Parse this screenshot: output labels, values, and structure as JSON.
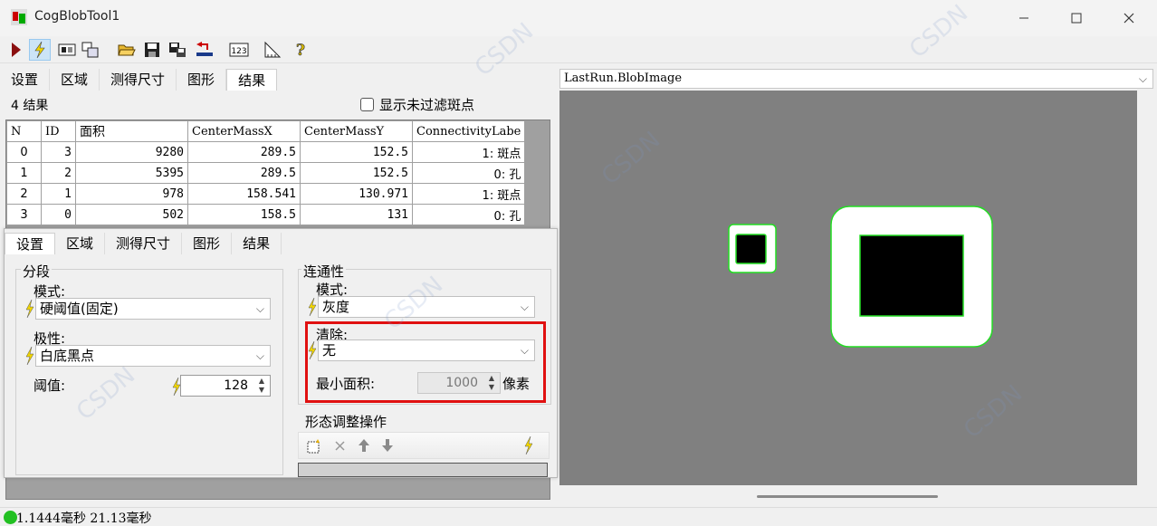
{
  "window": {
    "title": "CogBlobTool1"
  },
  "top_tabs": [
    "设置",
    "区域",
    "测得尺寸",
    "图形",
    "结果"
  ],
  "results": {
    "count_label": "4 结果",
    "show_unfiltered_label": "显示未过滤斑点",
    "columns": [
      "N",
      "ID",
      "面积",
      "CenterMassX",
      "CenterMassY",
      "ConnectivityLabe"
    ],
    "rows": [
      [
        "0",
        "3",
        "9280",
        "289.5",
        "152.5",
        "1: 斑点"
      ],
      [
        "1",
        "2",
        "5395",
        "289.5",
        "152.5",
        "0: 孔"
      ],
      [
        "2",
        "1",
        "978",
        "158.541",
        "130.971",
        "1: 斑点"
      ],
      [
        "3",
        "0",
        "502",
        "158.5",
        "131",
        "0: 孔"
      ]
    ]
  },
  "panel_tabs": [
    "设置",
    "区域",
    "测得尺寸",
    "图形",
    "结果"
  ],
  "segmentation": {
    "group_title": "分段",
    "mode_label": "模式:",
    "mode_value": "硬阈值(固定)",
    "polarity_label": "极性:",
    "polarity_value": "白底黑点",
    "threshold_label": "阈值:",
    "threshold_value": "128"
  },
  "connectivity": {
    "group_title": "连通性",
    "mode_label": "模式:",
    "mode_value": "灰度",
    "clear_label": "清除:",
    "clear_value": "无",
    "min_area_label": "最小面积:",
    "min_area_value": "1000",
    "min_area_unit": "像素"
  },
  "morphology": {
    "group_title": "形态调整操作"
  },
  "image_selector": {
    "value": "LastRun.BlobImage"
  },
  "status": {
    "text": "1.1444毫秒 21.13毫秒"
  },
  "colors": {
    "highlight": "#e01010",
    "blob_outline": "#22dd22",
    "image_bg": "#808080",
    "status_ok": "#22c022"
  }
}
